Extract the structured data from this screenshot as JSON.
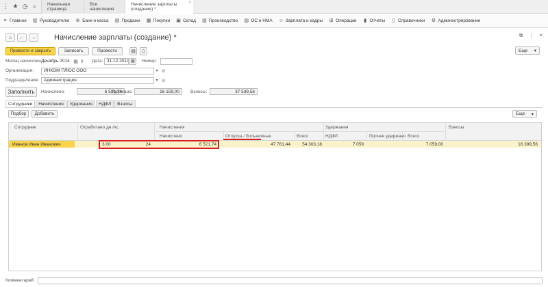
{
  "top_tabs": [
    {
      "label": "Начальная страница"
    },
    {
      "label": "Все начисления"
    },
    {
      "label": "Начисление зарплаты (создание) *"
    }
  ],
  "menu": [
    {
      "label": "Главное",
      "icon": "hamburger-icon"
    },
    {
      "label": "Руководителю",
      "icon": "chart-icon"
    },
    {
      "label": "Банк и касса",
      "icon": "bank-icon"
    },
    {
      "label": "Продажи",
      "icon": "cart-icon"
    },
    {
      "label": "Покупки",
      "icon": "basket-icon"
    },
    {
      "label": "Склад",
      "icon": "warehouse-icon"
    },
    {
      "label": "Производство",
      "icon": "factory-icon"
    },
    {
      "label": "ОС и НМА",
      "icon": "assets-icon"
    },
    {
      "label": "Зарплата и кадры",
      "icon": "people-icon"
    },
    {
      "label": "Операции",
      "icon": "operations-icon"
    },
    {
      "label": "Отчеты",
      "icon": "reports-icon"
    },
    {
      "label": "Справочники",
      "icon": "book-icon"
    },
    {
      "label": "Администрирование",
      "icon": "gear-icon"
    }
  ],
  "document": {
    "title": "Начисление зарплаты (создание) *"
  },
  "toolbar": {
    "post_close": "Провести и закрыть",
    "save": "Записать",
    "post": "Провести",
    "more": "Еще"
  },
  "fields": {
    "month_label": "Месяц начисления:",
    "month_value": "Декабрь 2014",
    "date_label": "Дата:",
    "date_value": "31.12.2014",
    "number_label": "Номер:",
    "number_value": "",
    "org_label": "Организация:",
    "org_value": "ИНКОМ ПЛЮС ООО",
    "dept_label": "Подразделение:",
    "dept_value": "Администрация"
  },
  "totals": {
    "fill_button": "Заполнить",
    "accrued_label": "Начислено:",
    "accrued_value": "6 521,74",
    "withheld_label": "Удержано:",
    "withheld_value": "16 159,00",
    "contrib_label": "Взносы:",
    "contrib_value": "37 539,56"
  },
  "inner_tabs": [
    {
      "label": "Сотрудники"
    },
    {
      "label": "Начисления"
    },
    {
      "label": "Удержания"
    },
    {
      "label": "НДФЛ"
    },
    {
      "label": "Взносы"
    }
  ],
  "table_toolbar": {
    "select": "Подбор",
    "add": "Добавить",
    "more": "Еще"
  },
  "table": {
    "headers": {
      "employee": "Сотрудник",
      "worked": "Отработано дн./чс.",
      "accruals": "Начисления",
      "accrual": "Начислено",
      "vacation": "Отпуска / больничные",
      "total1": "Всего",
      "deductions": "Удержания",
      "ndfl": "НДФЛ",
      "other": "Прочее удержано",
      "total2": "Всего",
      "contrib": "Взносы"
    },
    "rows": [
      {
        "employee": "Иванов Иван Иванович",
        "days": "3,00",
        "hours": "24",
        "accrued": "6 521,74",
        "vacation": "47 781,44",
        "total": "54 303,18",
        "ndfl": "7 059",
        "other": "",
        "deduct_total": "7 059,00",
        "contrib": "16 399,56"
      }
    ]
  },
  "comment": {
    "label": "Комментарий:",
    "value": ""
  }
}
